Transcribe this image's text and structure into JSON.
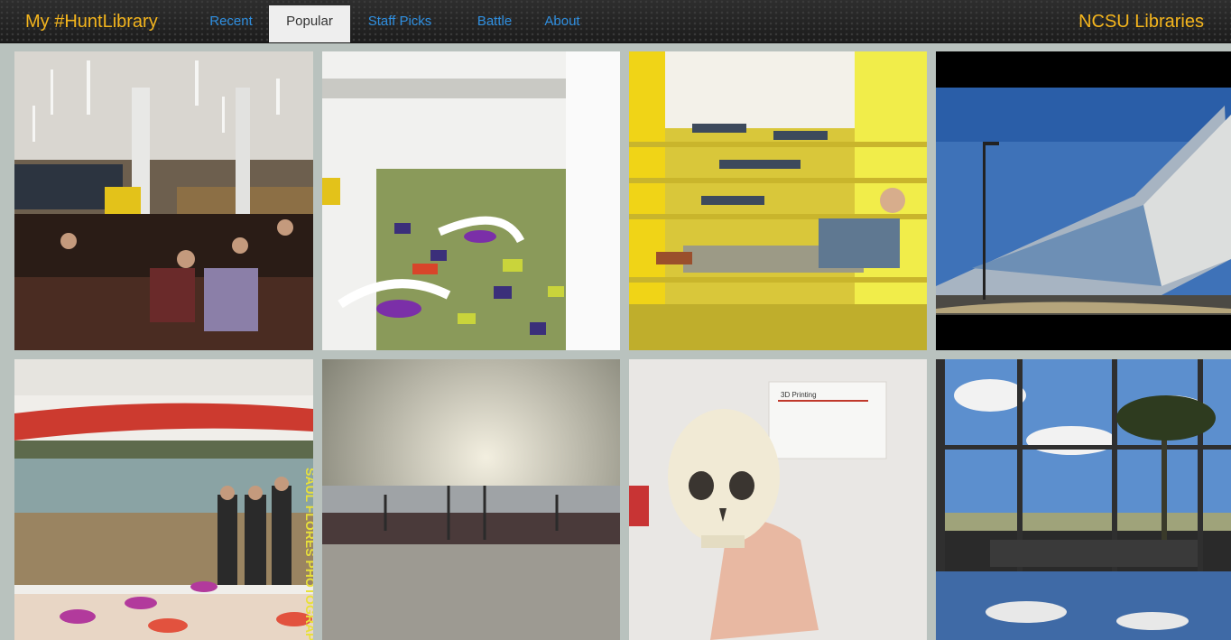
{
  "header": {
    "brand": "My #HuntLibrary",
    "org": "NCSU Libraries",
    "nav": [
      {
        "label": "Recent",
        "active": false
      },
      {
        "label": "Popular",
        "active": true
      },
      {
        "label": "Staff Picks",
        "active": false
      },
      {
        "label": "Battle",
        "active": false
      },
      {
        "label": "About",
        "active": false
      }
    ]
  },
  "photos": [
    {
      "name": "reading-room-photo"
    },
    {
      "name": "atrium-overview-photo"
    },
    {
      "name": "yellow-stairs-photo"
    },
    {
      "name": "building-exterior-photo"
    },
    {
      "name": "mural-group-photo",
      "overlay_text": "SAUL FLORES PHOTOGRAPHS"
    },
    {
      "name": "sky-reflection-photo"
    },
    {
      "name": "3d-printed-skull-photo",
      "overlay_text": "3D Printing"
    },
    {
      "name": "window-clouds-photo"
    }
  ],
  "colors": {
    "brand": "#f4b51d",
    "nav_link": "#2f8fe0",
    "nav_bg": "#262626",
    "page_bg": "#b9c2be"
  }
}
